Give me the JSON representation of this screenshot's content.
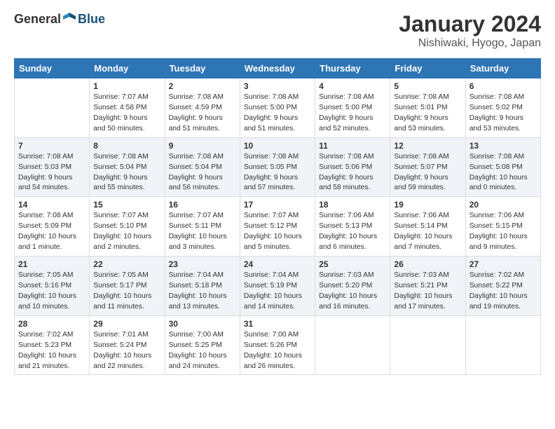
{
  "header": {
    "logo_general": "General",
    "logo_blue": "Blue",
    "month_title": "January 2024",
    "location": "Nishiwaki, Hyogo, Japan"
  },
  "days_of_week": [
    "Sunday",
    "Monday",
    "Tuesday",
    "Wednesday",
    "Thursday",
    "Friday",
    "Saturday"
  ],
  "weeks": [
    [
      {
        "num": "",
        "info": ""
      },
      {
        "num": "1",
        "info": "Sunrise: 7:07 AM\nSunset: 4:58 PM\nDaylight: 9 hours\nand 50 minutes."
      },
      {
        "num": "2",
        "info": "Sunrise: 7:08 AM\nSunset: 4:59 PM\nDaylight: 9 hours\nand 51 minutes."
      },
      {
        "num": "3",
        "info": "Sunrise: 7:08 AM\nSunset: 5:00 PM\nDaylight: 9 hours\nand 51 minutes."
      },
      {
        "num": "4",
        "info": "Sunrise: 7:08 AM\nSunset: 5:00 PM\nDaylight: 9 hours\nand 52 minutes."
      },
      {
        "num": "5",
        "info": "Sunrise: 7:08 AM\nSunset: 5:01 PM\nDaylight: 9 hours\nand 53 minutes."
      },
      {
        "num": "6",
        "info": "Sunrise: 7:08 AM\nSunset: 5:02 PM\nDaylight: 9 hours\nand 53 minutes."
      }
    ],
    [
      {
        "num": "7",
        "info": "Sunrise: 7:08 AM\nSunset: 5:03 PM\nDaylight: 9 hours\nand 54 minutes."
      },
      {
        "num": "8",
        "info": "Sunrise: 7:08 AM\nSunset: 5:04 PM\nDaylight: 9 hours\nand 55 minutes."
      },
      {
        "num": "9",
        "info": "Sunrise: 7:08 AM\nSunset: 5:04 PM\nDaylight: 9 hours\nand 56 minutes."
      },
      {
        "num": "10",
        "info": "Sunrise: 7:08 AM\nSunset: 5:05 PM\nDaylight: 9 hours\nand 57 minutes."
      },
      {
        "num": "11",
        "info": "Sunrise: 7:08 AM\nSunset: 5:06 PM\nDaylight: 9 hours\nand 58 minutes."
      },
      {
        "num": "12",
        "info": "Sunrise: 7:08 AM\nSunset: 5:07 PM\nDaylight: 9 hours\nand 59 minutes."
      },
      {
        "num": "13",
        "info": "Sunrise: 7:08 AM\nSunset: 5:08 PM\nDaylight: 10 hours\nand 0 minutes."
      }
    ],
    [
      {
        "num": "14",
        "info": "Sunrise: 7:08 AM\nSunset: 5:09 PM\nDaylight: 10 hours\nand 1 minute."
      },
      {
        "num": "15",
        "info": "Sunrise: 7:07 AM\nSunset: 5:10 PM\nDaylight: 10 hours\nand 2 minutes."
      },
      {
        "num": "16",
        "info": "Sunrise: 7:07 AM\nSunset: 5:11 PM\nDaylight: 10 hours\nand 3 minutes."
      },
      {
        "num": "17",
        "info": "Sunrise: 7:07 AM\nSunset: 5:12 PM\nDaylight: 10 hours\nand 5 minutes."
      },
      {
        "num": "18",
        "info": "Sunrise: 7:06 AM\nSunset: 5:13 PM\nDaylight: 10 hours\nand 6 minutes."
      },
      {
        "num": "19",
        "info": "Sunrise: 7:06 AM\nSunset: 5:14 PM\nDaylight: 10 hours\nand 7 minutes."
      },
      {
        "num": "20",
        "info": "Sunrise: 7:06 AM\nSunset: 5:15 PM\nDaylight: 10 hours\nand 9 minutes."
      }
    ],
    [
      {
        "num": "21",
        "info": "Sunrise: 7:05 AM\nSunset: 5:16 PM\nDaylight: 10 hours\nand 10 minutes."
      },
      {
        "num": "22",
        "info": "Sunrise: 7:05 AM\nSunset: 5:17 PM\nDaylight: 10 hours\nand 11 minutes."
      },
      {
        "num": "23",
        "info": "Sunrise: 7:04 AM\nSunset: 5:18 PM\nDaylight: 10 hours\nand 13 minutes."
      },
      {
        "num": "24",
        "info": "Sunrise: 7:04 AM\nSunset: 5:19 PM\nDaylight: 10 hours\nand 14 minutes."
      },
      {
        "num": "25",
        "info": "Sunrise: 7:03 AM\nSunset: 5:20 PM\nDaylight: 10 hours\nand 16 minutes."
      },
      {
        "num": "26",
        "info": "Sunrise: 7:03 AM\nSunset: 5:21 PM\nDaylight: 10 hours\nand 17 minutes."
      },
      {
        "num": "27",
        "info": "Sunrise: 7:02 AM\nSunset: 5:22 PM\nDaylight: 10 hours\nand 19 minutes."
      }
    ],
    [
      {
        "num": "28",
        "info": "Sunrise: 7:02 AM\nSunset: 5:23 PM\nDaylight: 10 hours\nand 21 minutes."
      },
      {
        "num": "29",
        "info": "Sunrise: 7:01 AM\nSunset: 5:24 PM\nDaylight: 10 hours\nand 22 minutes."
      },
      {
        "num": "30",
        "info": "Sunrise: 7:00 AM\nSunset: 5:25 PM\nDaylight: 10 hours\nand 24 minutes."
      },
      {
        "num": "31",
        "info": "Sunrise: 7:00 AM\nSunset: 5:26 PM\nDaylight: 10 hours\nand 26 minutes."
      },
      {
        "num": "",
        "info": ""
      },
      {
        "num": "",
        "info": ""
      },
      {
        "num": "",
        "info": ""
      }
    ]
  ]
}
